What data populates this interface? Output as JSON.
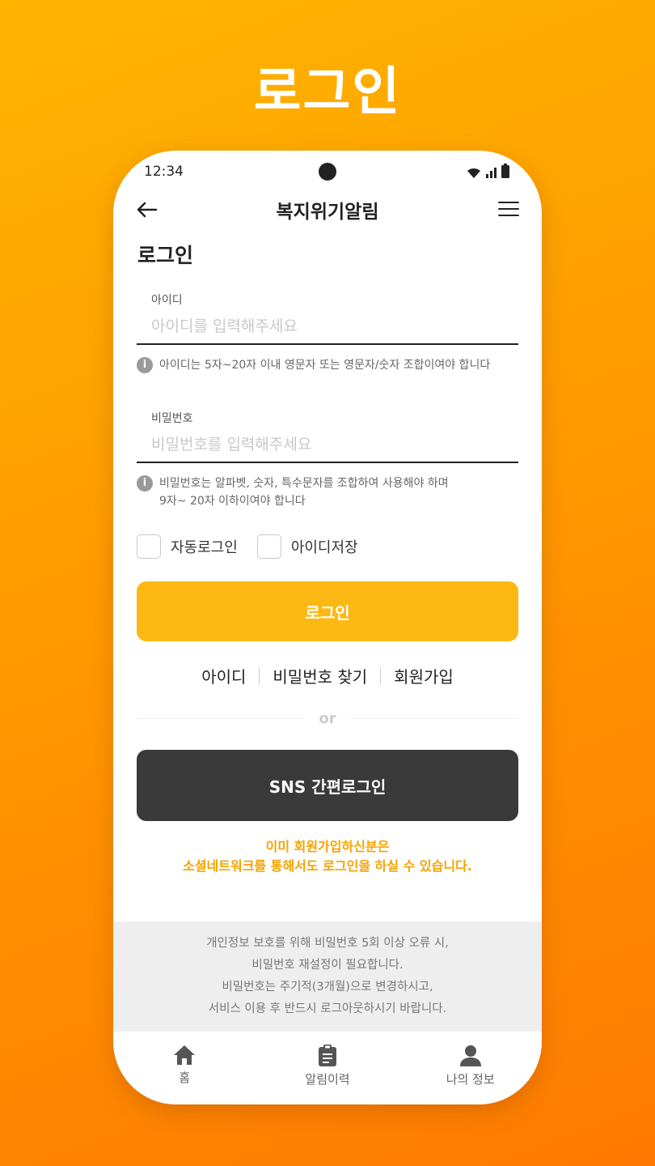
{
  "promo": {
    "title": "로그인"
  },
  "status_bar": {
    "time": "12:34"
  },
  "header": {
    "title": "복지위기알림"
  },
  "login": {
    "section_title": "로그인",
    "id_field": {
      "label": "아이디",
      "placeholder": "아이디를 입력해주세요"
    },
    "id_hint": "아이디는 5자~20자 이내 영문자 또는 영문자/숫자 조합이여야 합니다",
    "password_field": {
      "label": "비밀번호",
      "placeholder": "비밀번호를 입력해주세요"
    },
    "password_hint_line1": "비밀번호는 알파벳, 숫자, 특수문자를 조합하여 사용해야 하며",
    "password_hint_line2": "9자~ 20자 이하이여야 합니다",
    "auto_login_label": "자동로그인",
    "save_id_label": "아이디저장",
    "login_button": "로그인",
    "links": {
      "find_id": "아이디",
      "find_password": "비밀번호 찾기",
      "sign_up": "회원가입"
    },
    "divider_text": "or",
    "sns_button": "SNS 간편로그인",
    "sns_note_line1": "이미 회원가입하신분은",
    "sns_note_line2": "소셜네트워크를 통해서도 로그인을 하실 수 있습니다."
  },
  "notice": {
    "line1": "개인정보 보호를 위해 비밀번호 5회 이상 오류 시,",
    "line2": "비밀번호 재설정이 필요합니다.",
    "line3": "비밀번호는 주기적(3개월)으로 변경하시고,",
    "line4": "서비스 이용 후 반드시 로그아웃하시기 바랍니다."
  },
  "bottom_nav": {
    "home": "홈",
    "alerts": "알림이력",
    "profile": "나의 정보"
  },
  "colors": {
    "accent": "#fdb913",
    "dark_button": "#3a3a3a",
    "note": "#f5a300"
  },
  "icons": {
    "back": "arrow-left-icon",
    "menu": "hamburger-menu-icon",
    "info": "info-icon",
    "home": "home-icon",
    "alerts": "clipboard-icon",
    "profile": "person-icon"
  }
}
